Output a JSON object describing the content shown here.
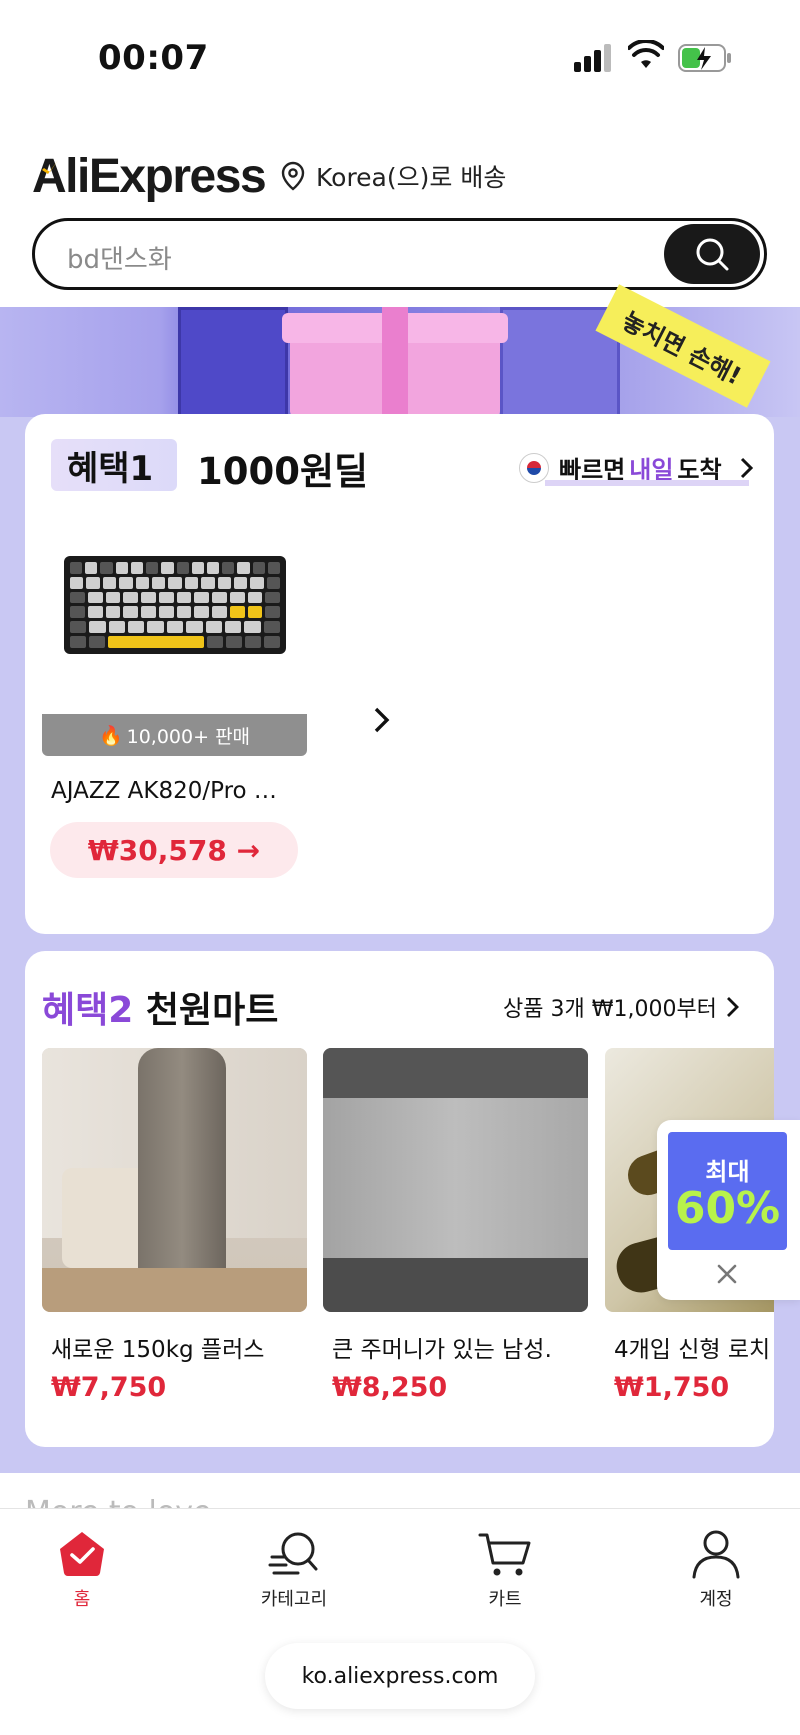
{
  "status_bar": {
    "time": "00:07"
  },
  "header": {
    "logo": "AliExpress",
    "ship_to": "Korea(으)로 배송",
    "search": {
      "placeholder": "bd댄스화"
    }
  },
  "banner": {
    "sticker": "놓치면 손해!"
  },
  "deal1": {
    "tag": "혜택1",
    "title": "1000원딜",
    "fast_prefix": "빠르면 ",
    "fast_highlight": "내일",
    "fast_suffix": " 도착",
    "product": {
      "sold": "10,000+ 판매",
      "name": "AJAZZ AK820/Pro …",
      "price": "₩30,578 →"
    }
  },
  "deal2": {
    "tag": "혜택2",
    "title": " 천원마트",
    "more": "상품 3개 ₩1,000부터",
    "products": [
      {
        "name": "새로운 150kg 플러스 …",
        "price": "₩7,750"
      },
      {
        "name": "큰 주머니가 있는 남성…",
        "price": "₩8,250"
      },
      {
        "name": "4개입 신형 로치",
        "price": "₩1,750"
      }
    ]
  },
  "promo": {
    "top": "최대",
    "percent": "60%"
  },
  "more_to_love": "More to love",
  "tabbar": {
    "home": "홈",
    "category": "카테고리",
    "cart": "카트",
    "account": "계정"
  },
  "browser": {
    "url": "ko.aliexpress.com"
  },
  "colors": {
    "accent_red": "#e0273a",
    "purple": "#8a49d8",
    "promo_blue": "#5a6cf0",
    "promo_green": "#b8f24b"
  }
}
